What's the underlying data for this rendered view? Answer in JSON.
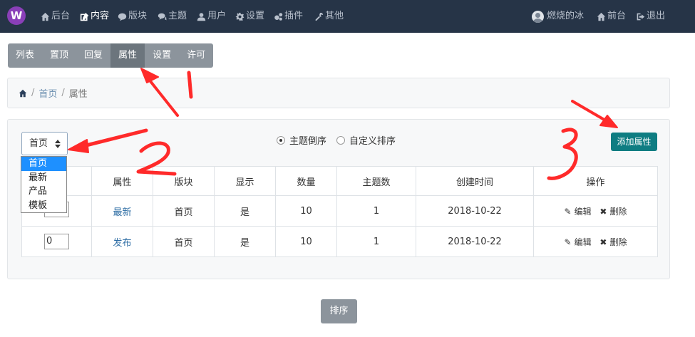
{
  "navbar": {
    "logo": "W",
    "items": [
      {
        "label": "后台",
        "icon": "home-icon"
      },
      {
        "label": "内容",
        "icon": "edit-icon"
      },
      {
        "label": "版块",
        "icon": "comment-icon"
      },
      {
        "label": "主题",
        "icon": "comments-icon"
      },
      {
        "label": "用户",
        "icon": "user-icon"
      },
      {
        "label": "设置",
        "icon": "gear-icon"
      },
      {
        "label": "插件",
        "icon": "gears-icon"
      },
      {
        "label": "其他",
        "icon": "wrench-icon"
      }
    ],
    "user_name": "燃烧的冰",
    "frontend_label": "前台",
    "logout_label": "退出"
  },
  "tabs": [
    "列表",
    "置顶",
    "回复",
    "属性",
    "设置",
    "许可"
  ],
  "breadcrumb": {
    "items": [
      "首页",
      "属性"
    ]
  },
  "select": {
    "value": "首页",
    "options": [
      "首页",
      "最新",
      "产品",
      "模板"
    ]
  },
  "radios": [
    {
      "label": "主题倒序",
      "checked": true
    },
    {
      "label": "自定义排序",
      "checked": false
    }
  ],
  "add_button": "添加属性",
  "table": {
    "headers": [
      "属性",
      "版块",
      "显示",
      "数量",
      "主题数",
      "创建时间",
      "操作"
    ],
    "rows": [
      {
        "order": "",
        "attr": "最新",
        "board": "首页",
        "show": "是",
        "count": "10",
        "topics": "1",
        "date": "2018-10-22",
        "edit": "编辑",
        "delete": "删除"
      },
      {
        "order": "0",
        "attr": "发布",
        "board": "首页",
        "show": "是",
        "count": "10",
        "topics": "1",
        "date": "2018-10-22",
        "edit": "编辑",
        "delete": "删除"
      }
    ]
  },
  "sort_button": "排序",
  "annotations": [
    "1",
    "2",
    "3"
  ],
  "colors": {
    "navbar": "#263447",
    "accent": "#0e7d82",
    "annotation": "#ff2a2a",
    "selected": "#1e90ff"
  }
}
